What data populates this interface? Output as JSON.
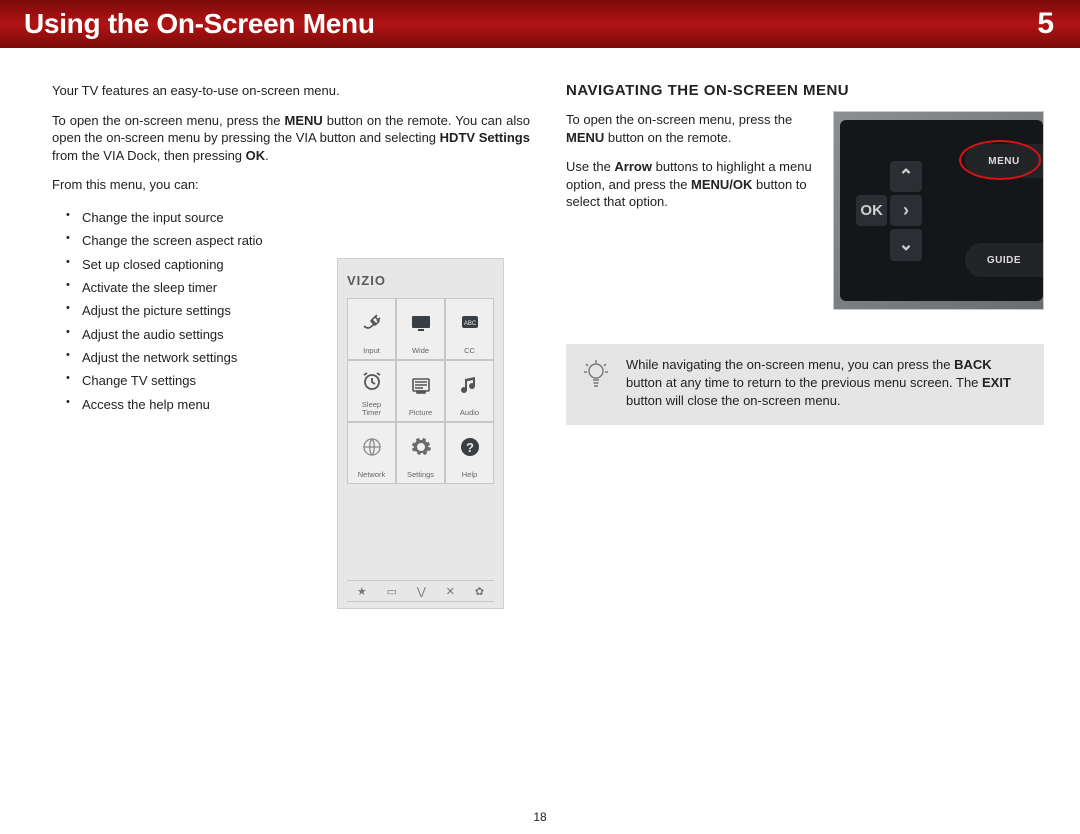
{
  "banner": {
    "title": "Using the On-Screen Menu",
    "chapter": "5"
  },
  "left": {
    "intro": "Your TV features an easy-to-use on-screen menu.",
    "p2a": "To open the on-screen menu, press the ",
    "p2b": " button on the remote. You can also open the on-screen menu by pressing the VIA button and selecting ",
    "p2c": " from the VIA Dock, then pressing ",
    "p2d": ".",
    "menu_bold": "MENU",
    "hdtv_bold": "HDTV Settings",
    "ok_bold": "OK",
    "from_menu": "From this menu, you can:",
    "bullets": [
      "Change the input source",
      "Change the screen aspect ratio",
      "Set up closed captioning",
      "Activate the sleep timer",
      "Adjust the picture settings",
      "Adjust the audio settings",
      "Adjust the network settings",
      "Change TV settings",
      "Access the help menu"
    ]
  },
  "vizio": {
    "logo": "VIZIO",
    "cells": [
      {
        "id": "input",
        "label": "Input"
      },
      {
        "id": "wide",
        "label": "Wide"
      },
      {
        "id": "cc",
        "label": "CC",
        "badge": "ABC"
      },
      {
        "id": "sleep",
        "label": "Sleep\nTimer"
      },
      {
        "id": "picture",
        "label": "Picture"
      },
      {
        "id": "audio",
        "label": "Audio"
      },
      {
        "id": "network",
        "label": "Network"
      },
      {
        "id": "settings",
        "label": "Settings"
      },
      {
        "id": "help",
        "label": "Help"
      }
    ],
    "footer_icons": [
      "★",
      "▭",
      "⋁",
      "✕",
      "✿"
    ]
  },
  "right": {
    "heading": "NAVIGATING THE ON-SCREEN MENU",
    "p1a": "To open the on-screen menu, press the ",
    "p1b": " button on the remote.",
    "menu_bold": "MENU",
    "p2a": "Use the ",
    "arrow_bold": "Arrow",
    "p2b": " buttons to highlight a menu option, and press the ",
    "menuok_bold": "MENU/OK",
    "p2c": " button to select that option.",
    "remote": {
      "ok": "OK",
      "menu": "MENU",
      "guide": "GUIDE"
    },
    "tip_a": "While navigating the on-screen menu, you can press the ",
    "back_bold": "BACK",
    "tip_b": " button at any time to return to the previous menu screen. The ",
    "exit_bold": "EXIT",
    "tip_c": " button will close the on-screen menu."
  },
  "page_number": "18"
}
